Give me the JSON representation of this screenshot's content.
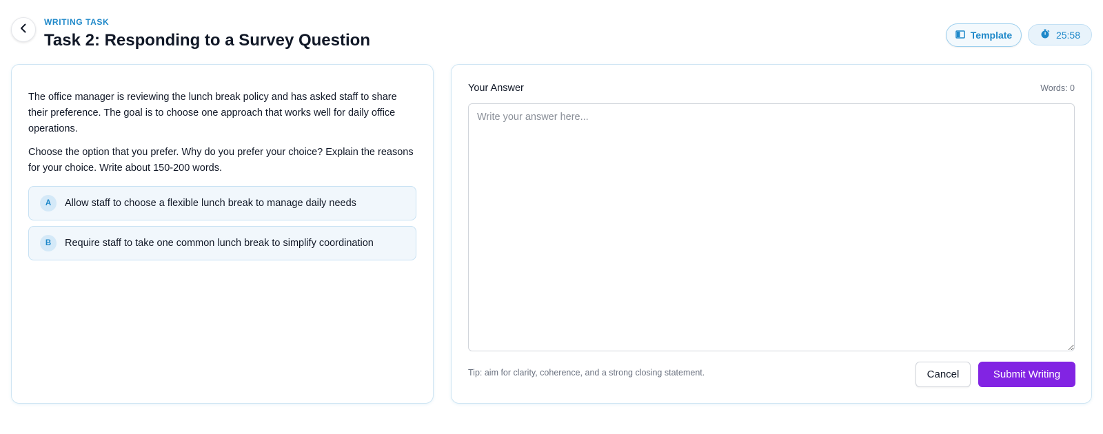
{
  "header": {
    "back_icon": "chevron-left-icon",
    "eyebrow": "WRITING TASK",
    "title": "Task 2: Responding to a Survey Question",
    "template_label": "Template",
    "template_icon": "book-open-icon",
    "timer_icon": "stopwatch-icon",
    "timer_value": "25:58"
  },
  "prompt": {
    "paragraph_1": "The office manager is reviewing the lunch break policy and has asked staff to share their preference. The goal is to choose one approach that works well for daily office operations.",
    "paragraph_2": "Choose the option that you prefer. Why do you prefer your choice? Explain the reasons for your choice. Write about 150-200 words.",
    "options": [
      {
        "letter": "A",
        "text": "Allow staff to choose a flexible lunch break to manage daily needs"
      },
      {
        "letter": "B",
        "text": "Require staff to take one common lunch break to simplify coordination"
      }
    ]
  },
  "answer": {
    "label": "Your Answer",
    "word_count_label": "Words: 0",
    "value": "",
    "placeholder": "Write your answer here...",
    "tip": "Tip: aim for clarity, coherence, and a strong closing statement.",
    "cancel_label": "Cancel",
    "submit_label": "Submit Writing"
  },
  "colors": {
    "accent_blue": "#1e88c9",
    "submit_purple": "#8224e3",
    "card_border": "#cfe5f3",
    "option_bg": "#f1f7fc"
  }
}
